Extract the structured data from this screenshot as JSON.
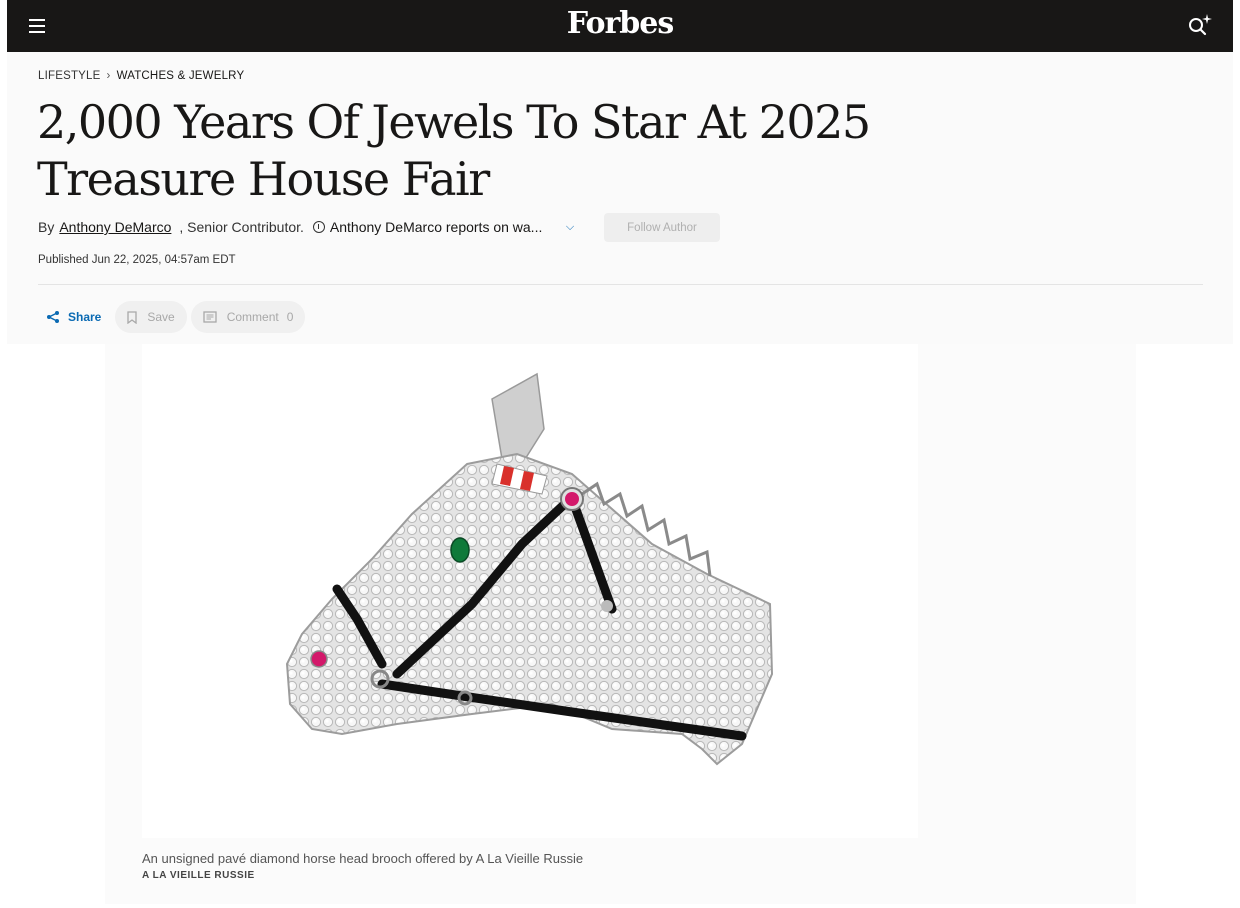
{
  "header": {
    "logo": "Forbes",
    "menu_icon": "hamburger-menu-icon",
    "search_icon": "search-sparkle-icon",
    "background": "#181716"
  },
  "breadcrumb": {
    "section": "LIFESTYLE",
    "subsection": "WATCHES & JEWELRY"
  },
  "article": {
    "title": "2,000 Years Of Jewels To Star At 2025 Treasure House Fair",
    "by_label": "By",
    "author": "Anthony DeMarco",
    "role": ", Senior Contributor.",
    "bio": "Anthony DeMarco reports on wa...",
    "follow_label": "Follow Author",
    "published": "Published Jun 22, 2025, 04:57am EDT"
  },
  "actions": {
    "share_label": "Share",
    "save_label": "Save",
    "comment_label": "Comment",
    "comment_count": "0",
    "accent": "#0a6ab3"
  },
  "figure": {
    "image_alt": "pave diamond horse head brooch",
    "caption": "An unsigned pavé diamond horse head brooch offered by A La Vieille Russie",
    "credit": "A LA VIEILLE RUSSIE"
  }
}
